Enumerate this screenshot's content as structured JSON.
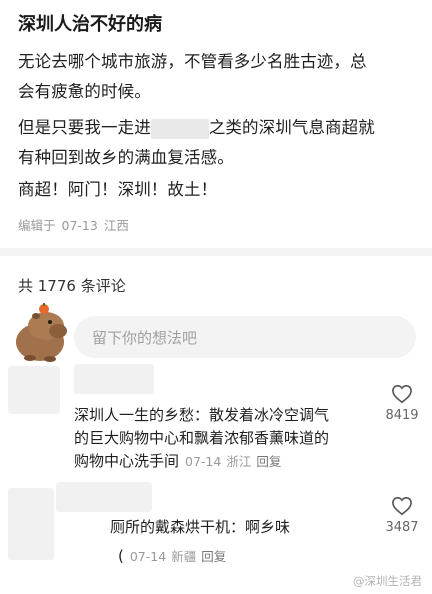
{
  "post": {
    "title": "深圳人治不好的病",
    "lines": {
      "l1": "无论去哪个城市旅游，不管看多少名胜古迹，总",
      "l2": "会有疲惫的时候。",
      "l3a": "但是只要我一走进",
      "l3b": "之类的深圳气息商超就",
      "l4": "有种回到故乡的满血复活感。",
      "l5": "商超！阿门！深圳！故土！"
    },
    "edit_label": "编辑于",
    "date": "07-13",
    "location": "江西"
  },
  "comments_section": {
    "count_text": "共 1776 条评论",
    "input_placeholder": "留下你的想法吧"
  },
  "comments": [
    {
      "lines": [
        "深圳人一生的乡愁：散发着冰冷空调气",
        "的巨大购物中心和飘着浓郁香薰味道的",
        "购物中心洗手间"
      ],
      "date": "07-14",
      "location": "浙江",
      "reply_label": "回复",
      "likes": "8419"
    },
    {
      "lines": [
        "厕所的戴森烘干机：啊乡味"
      ],
      "prefix": "(",
      "date": "07-14",
      "location": "新疆",
      "reply_label": "回复",
      "likes": "3487"
    }
  ],
  "watermark": "@深圳生活君",
  "colors": {
    "meta": "#9a9a9a",
    "redacted": "#e9e9ea",
    "input_bg": "#f3f3f3"
  },
  "icons": [
    "heart-outline-icon",
    "capybara-mascot"
  ]
}
